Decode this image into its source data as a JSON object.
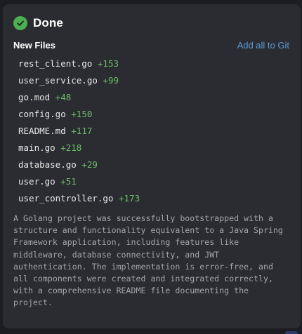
{
  "header": {
    "status_icon": "check-circle-icon",
    "status_color": "#4caf50",
    "title": "Done"
  },
  "files_section": {
    "title": "New Files",
    "action_label": "Add all to Git",
    "files": [
      {
        "name": "rest_client.go",
        "added": "+153"
      },
      {
        "name": "user_service.go",
        "added": "+99"
      },
      {
        "name": "go.mod",
        "added": "+48"
      },
      {
        "name": "config.go",
        "added": "+150"
      },
      {
        "name": "README.md",
        "added": "+117"
      },
      {
        "name": "main.go",
        "added": "+218"
      },
      {
        "name": "database.go",
        "added": "+29"
      },
      {
        "name": "user.go",
        "added": "+51"
      },
      {
        "name": "user_controller.go",
        "added": "+173"
      }
    ]
  },
  "summary": "A Golang project was successfully bootstrapped with a structure and functionality equivalent to a Java Spring Framework application, including features like middleware, database connectivity, and JWT authentication. The implementation is error-free, and all components were created and integrated correctly, with a comprehensive README file documenting the project.",
  "colors": {
    "background": "#1c1d21",
    "panel": "#2b2c31",
    "link": "#5b9bd5",
    "added": "#6dbb6a",
    "summary_text": "#a4a4a8"
  }
}
